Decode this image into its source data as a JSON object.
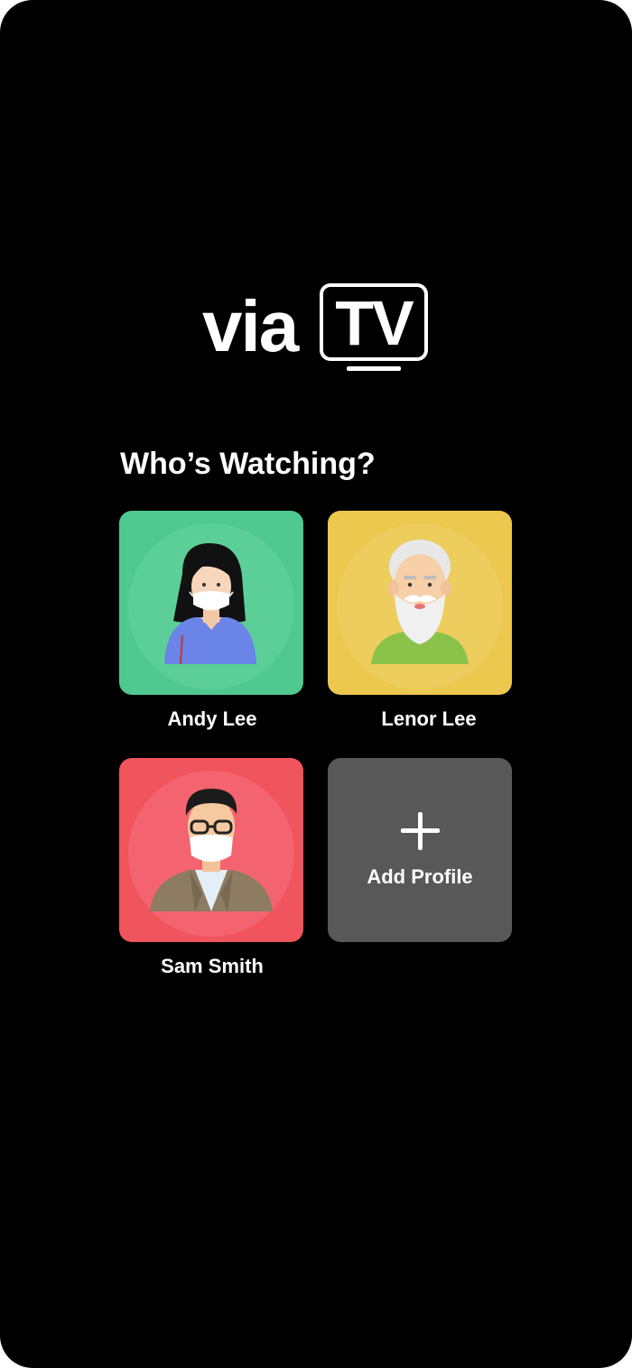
{
  "app": {
    "logo_text_via": "via",
    "logo_text_tv": "TV"
  },
  "page": {
    "heading": "Who’s Watching?"
  },
  "profiles": [
    {
      "name": "Andy Lee",
      "avatar": "woman-with-mask-avatar",
      "color": "#4fc98f"
    },
    {
      "name": "Lenor Lee",
      "avatar": "old-man-with-beard-avatar",
      "color": "#ecc84e"
    },
    {
      "name": "Sam Smith",
      "avatar": "man-with-glasses-and-mask-avatar",
      "color": "#f0545c"
    }
  ],
  "add_profile": {
    "label": "Add Profile",
    "icon": "plus-icon",
    "color": "#585858"
  }
}
